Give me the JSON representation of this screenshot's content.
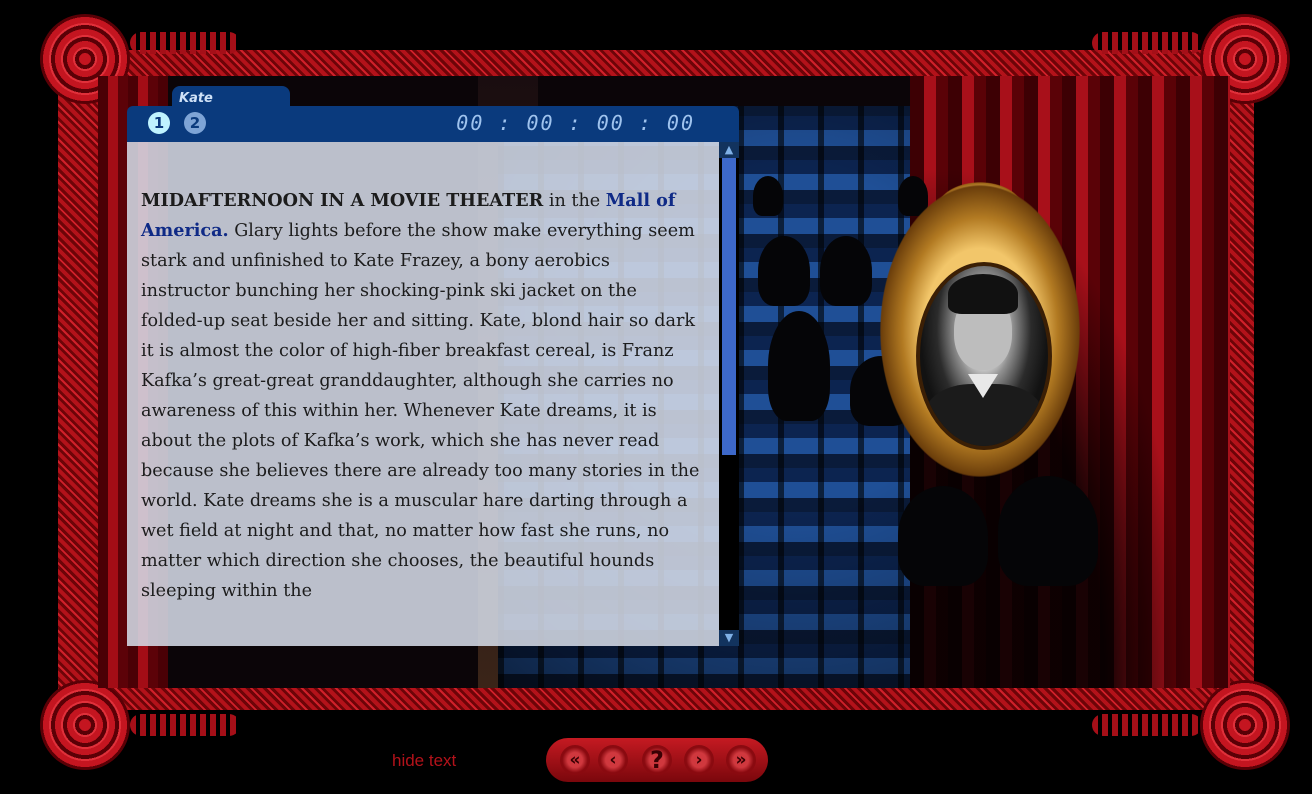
{
  "tab": {
    "name": "Kate"
  },
  "chapters": [
    {
      "label": "1"
    },
    {
      "label": "2"
    }
  ],
  "timer": "00 : 00 : 00 : 00",
  "story": {
    "lead": "MIDAFTERNOON IN A MOVIE THEATER",
    "lead_tail": " in the ",
    "link": "Mall of America.",
    "body": " Glary lights before the show make everything seem stark and unfinished to Kate Frazey, a bony aerobics instructor bunching her shocking-pink ski jacket on the folded-up seat beside her and sitting. Kate, blond hair so dark it is almost the color of high-fiber breakfast cereal, is Franz Kafka’s great-great granddaughter, although she carries no awareness of this within her. Whenever Kate dreams, it is about the plots of Kafka’s work, which she has never read because she believes there are already too many stories in the world. Kate dreams she is a muscular hare darting through a wet field at night and that, no matter how fast she runs, no matter which direction she chooses, the beautiful hounds sleeping within the"
  },
  "scrollbar": {
    "position": 0.0,
    "visible_fraction": 0.63
  },
  "footer": {
    "hide_text": "hide text"
  },
  "nav_buttons": [
    {
      "icon": "swirl-left-double-icon"
    },
    {
      "icon": "swirl-left-icon"
    },
    {
      "icon": "help-icon",
      "label": "?"
    },
    {
      "icon": "swirl-right-icon"
    },
    {
      "icon": "swirl-right-double-icon"
    }
  ],
  "colors": {
    "frame": "#b3121a",
    "panel_header": "#0a3a7d",
    "link": "#0f2a86",
    "scroll_thumb": "#3d68c9"
  }
}
